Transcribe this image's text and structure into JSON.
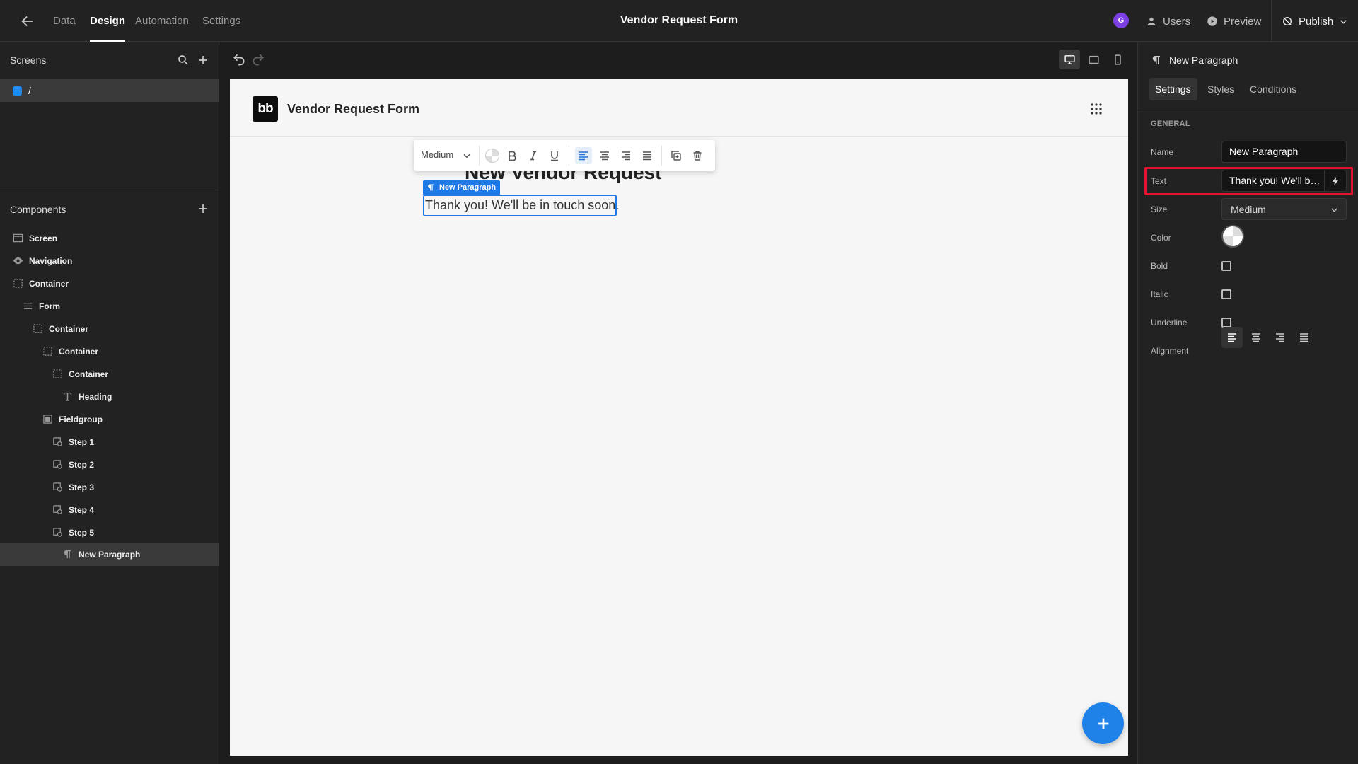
{
  "topbar": {
    "tabs": [
      {
        "label": "Data",
        "active": false
      },
      {
        "label": "Design",
        "active": true
      },
      {
        "label": "Automation",
        "active": false
      },
      {
        "label": "Settings",
        "active": false
      }
    ],
    "app_title": "Vendor Request Form",
    "avatar_initial": "G",
    "users_label": "Users",
    "preview_label": "Preview",
    "publish_label": "Publish",
    "avatar_color": "#7b3fe4"
  },
  "screens_panel": {
    "title": "Screens",
    "screens": [
      {
        "label": "/",
        "color": "#1e8bf0"
      }
    ]
  },
  "components_panel": {
    "title": "Components",
    "items": [
      {
        "label": "Screen",
        "icon": "screen-icon"
      },
      {
        "label": "Navigation",
        "icon": "eye-icon"
      },
      {
        "label": "Container",
        "icon": "container-icon"
      },
      {
        "label": "Form",
        "icon": "form-icon"
      },
      {
        "label": "Container",
        "icon": "container-icon"
      },
      {
        "label": "Container",
        "icon": "container-icon"
      },
      {
        "label": "Container",
        "icon": "container-icon"
      },
      {
        "label": "Heading",
        "icon": "heading-icon"
      },
      {
        "label": "Fieldgroup",
        "icon": "fieldgroup-icon"
      },
      {
        "label": "Step 1",
        "icon": "step-icon"
      },
      {
        "label": "Step 2",
        "icon": "step-icon"
      },
      {
        "label": "Step 3",
        "icon": "step-icon"
      },
      {
        "label": "Step 4",
        "icon": "step-icon"
      },
      {
        "label": "Step 5",
        "icon": "step-icon"
      },
      {
        "label": "New Paragraph",
        "icon": "paragraph-icon",
        "selected": true
      }
    ]
  },
  "canvas": {
    "app_header_title": "Vendor Request Form",
    "logo_text": "bb",
    "heading_text": "New Vendor Request",
    "toolbar": {
      "size_value": "Medium"
    },
    "selection_tag": "New Paragraph",
    "paragraph_text": "Thank you! We'll be in touch soon.",
    "accent_color": "#1e78e6"
  },
  "settings_panel": {
    "component_title": "New Paragraph",
    "tabs": [
      {
        "label": "Settings",
        "active": true
      },
      {
        "label": "Styles",
        "active": false
      },
      {
        "label": "Conditions",
        "active": false
      }
    ],
    "section_title": "GENERAL",
    "labels": {
      "name": "Name",
      "text": "Text",
      "size": "Size",
      "color": "Color",
      "bold": "Bold",
      "italic": "Italic",
      "underline": "Underline",
      "alignment": "Alignment"
    },
    "name_value": "New Paragraph",
    "text_value": "Thank you! We'll be in touch soon.",
    "size_value": "Medium",
    "bold": false,
    "italic": false,
    "underline": false,
    "alignment": "left",
    "highlight_color": "#e3132d"
  }
}
